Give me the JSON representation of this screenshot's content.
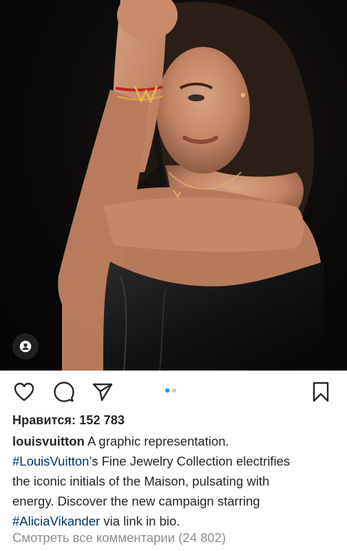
{
  "post": {
    "photo": {
      "description_icon": "person-icon"
    },
    "carousel": {
      "total": 2,
      "current": 1
    },
    "likes_text": "Нравится: 152 783",
    "caption": {
      "username": "louisvuitton",
      "line1_text": " A graphic representation.",
      "hashtag1": "#LouisVuitton",
      "line2_text": "’s Fine Jewelry Collection electrifies",
      "line3_text": "the iconic initials of the Maison, pulsating with",
      "line4_text": "energy. Discover the new campaign starring",
      "hashtag2": "#AliciaVikander",
      "line5_text": " via link in bio."
    },
    "view_comments_text": "Смотреть все комментарии (24 802)"
  },
  "icons": {
    "like": "heart-icon",
    "comment": "comment-icon",
    "share": "paper-plane-icon",
    "save": "bookmark-icon"
  },
  "colors": {
    "link": "#00376b",
    "carousel_active": "#0095f6",
    "muted": "#8e8e8e"
  }
}
